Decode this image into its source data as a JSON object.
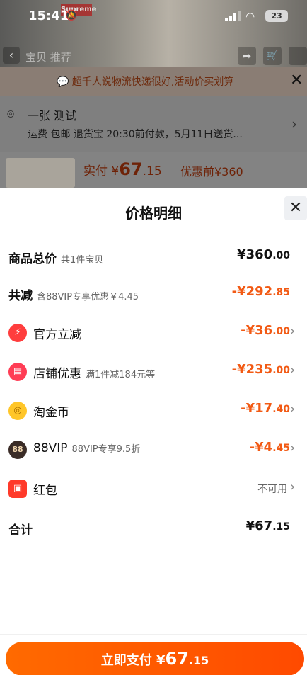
{
  "status_bar": {
    "time": "15:41",
    "battery": "23",
    "brand_tag": "Supreme"
  },
  "top_nav": {
    "tabs": "宝贝  推荐"
  },
  "notice": {
    "text": "超千人说物流快递很好,活动价买划算"
  },
  "address": {
    "name": "一张 测试",
    "shipping": "运费 包邮 退货宝 20:30前付款，5月11日送货..."
  },
  "order_summary": {
    "pay_prefix": "实付 ¥",
    "pay_value": "67",
    "pay_cents": ".15",
    "pre_discount": "优惠前¥360"
  },
  "sheet": {
    "title": "价格明细",
    "rows": [
      {
        "label": "商品总价",
        "sub": "共1件宝贝",
        "amount": "¥360",
        "cents": ".00"
      },
      {
        "label": "共减",
        "sub": "含88VIP专享优惠￥4.45",
        "amount": "-¥292",
        "cents": ".85"
      },
      {
        "label": "官方立减",
        "sub": "",
        "amount": "-¥36",
        "cents": ".00",
        "icon": "lightning-icon"
      },
      {
        "label": "店铺优惠",
        "sub": "满1件减184元等",
        "amount": "-¥235",
        "cents": ".00",
        "icon": "shop-icon"
      },
      {
        "label": "淘金币",
        "sub": "",
        "amount": "-¥17",
        "cents": ".40",
        "icon": "coin-icon"
      },
      {
        "label": "88VIP",
        "sub": "88VIP专享9.5折",
        "amount": "-¥4",
        "cents": ".45",
        "icon": "vip88-icon",
        "icon_text": "88"
      },
      {
        "label": "红包",
        "sub": "",
        "status": "不可用",
        "icon": "red-packet-icon"
      },
      {
        "label": "合计",
        "sub": "",
        "amount": "¥67",
        "cents": ".15"
      }
    ]
  },
  "pay_button": {
    "prefix": "立即支付 ¥",
    "value": "67",
    "cents": ".15"
  },
  "colors": {
    "accent": "#ff5000",
    "discount": "#f25a14"
  }
}
